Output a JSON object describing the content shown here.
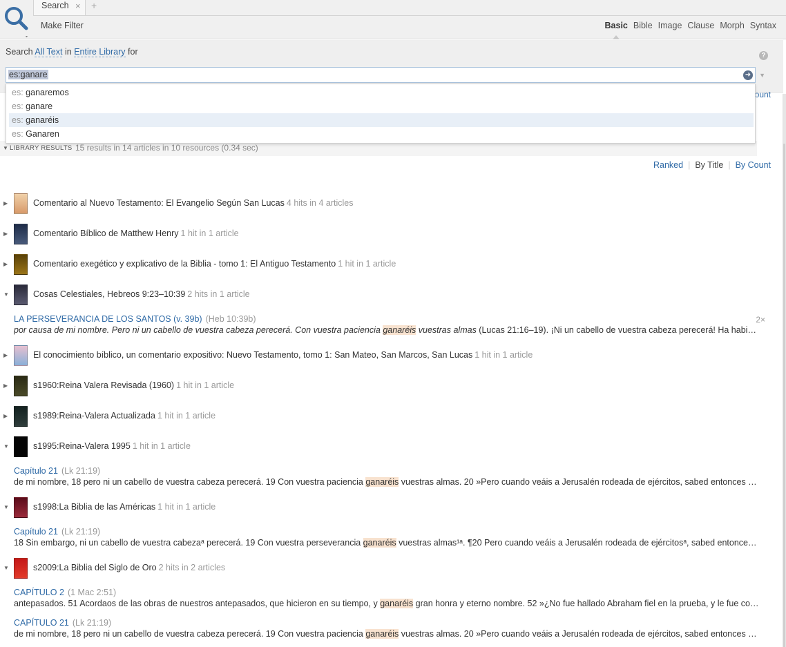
{
  "tab": {
    "label": "Search",
    "close": "×",
    "add": "+"
  },
  "toolbar": {
    "make_filter": "Make Filter",
    "modes": [
      "Basic",
      "Bible",
      "Image",
      "Clause",
      "Morph",
      "Syntax"
    ],
    "active_mode": "Basic"
  },
  "search": {
    "prefix": "Search",
    "scope": "All Text",
    "in": "in",
    "library": "Entire Library",
    "for": "for",
    "query": "es:ganare",
    "help": "?"
  },
  "suggestions": [
    {
      "prefix": "es:",
      "word": "ganaremos"
    },
    {
      "prefix": "es:",
      "word": "ganare"
    },
    {
      "prefix": "es:",
      "word": "ganaréis"
    },
    {
      "prefix": "es:",
      "word": "Ganaren"
    }
  ],
  "partial_count": "ount",
  "results": {
    "title": "Library Results",
    "summary": "15 results in 14 articles in 10 resources (0.34 sec)",
    "sort": [
      "Ranked",
      "By Title",
      "By Count"
    ],
    "active_sort": "By Title"
  },
  "colors": {
    "link": "#2f6aa6",
    "match_highlight": "#f8e2cf"
  },
  "resources": [
    {
      "title": "Comentario al Nuevo Testamento: El Evangelio Según San Lucas",
      "hits": "4 hits in 4 articles",
      "expanded": false,
      "cover": "#e8b88a"
    },
    {
      "title": "Comentario Bíblico de Matthew Henry",
      "hits": "1 hit in 1 article",
      "expanded": false,
      "cover": "#2c3e5a"
    },
    {
      "title": "Comentario exegético y explicativo de la Biblia - tomo 1: El Antiguo Testamento",
      "hits": "1 hit in 1 article",
      "expanded": false,
      "cover": "#7a5a10"
    },
    {
      "title": "Cosas Celestiales, Hebreos 9:23–10:39",
      "hits": "2 hits in 1 article",
      "expanded": true,
      "cover": "#3c3c50",
      "hits_list": [
        {
          "heading": "LA PERSEVERANCIA DE LOS SANTOS (v. 39b)",
          "ref": "(Heb 10:39b)",
          "before": "por causa de mi nombre. Pero ni un cabello de vuestra cabeza perecerá. Con vuestra paciencia ",
          "match": "ganaréis",
          "after": " vuestras almas",
          "tail": " (Lucas 21:16–19). ¡Ni un cabello de vuestra cabeza perecerá! Ha habido…",
          "count": "2×"
        }
      ]
    },
    {
      "title": "El conocimiento bíblico, un comentario expositivo: Nuevo Testamento, tomo 1: San Mateo, San Marcos, San Lucas",
      "hits": "1 hit in 1 article",
      "expanded": false,
      "cover": "#c9a0b0"
    },
    {
      "title": "s1960:Reina Valera Revisada (1960)",
      "hits": "1 hit in 1 article",
      "expanded": false,
      "cover": "#3a3a20"
    },
    {
      "title": "s1989:Reina-Valera Actualizada",
      "hits": "1 hit in 1 article",
      "expanded": false,
      "cover": "#1c2a28"
    },
    {
      "title": "s1995:Reina-Valera 1995",
      "hits": "1 hit in 1 article",
      "expanded": true,
      "cover": "#0c0c0c",
      "hits_list": [
        {
          "heading": "Capítulo 21",
          "ref": "(Lk 21:19)",
          "before": "de mi nombre, 18 pero ni un cabello de vuestra cabeza perecerá. 19 Con vuestra paciencia ",
          "match": "ganaréis",
          "after": " vuestras almas. 20 »Pero cuando veáis a Jerusalén rodeada de ejércitos, sabed entonces que…"
        }
      ]
    },
    {
      "title": "s1998:La Biblia de las Américas",
      "hits": "1 hit in 1 article",
      "expanded": true,
      "cover": "#6a1020",
      "hits_list": [
        {
          "heading": "Capítulo 21",
          "ref": "(Lk 21:19)",
          "before": "18 Sin embargo, ni un cabello de vuestra cabezaᵃ perecerá. 19 Con vuestra perseverancia ",
          "match": "ganaréis",
          "after": " vuestras almas¹ᵃ. ¶20 Pero cuando veáis a Jerusalén rodeada de ejércitosᵃ, sabed entonces…"
        }
      ]
    },
    {
      "title": "s2009:La Biblia del Siglo de Oro",
      "hits": "2 hits in 2 articles",
      "expanded": true,
      "cover": "#c42020",
      "hits_list": [
        {
          "heading": "CAPÍTULO 2",
          "ref": "(1 Mac 2:51)",
          "before": "antepasados. 51 Acordaos de las obras de nuestros antepasados, que hicieron en su tiempo, y ",
          "match": "ganaréis",
          "after": " gran honra y eterno nombre. 52 »¿No fue hallado Abraham fiel en la prueba, y le fue contado…"
        },
        {
          "heading": "CAPÍTULO 21",
          "ref": "(Lk 21:19)",
          "before": "de mi nombre, 18 pero ni un cabello de vuestra cabeza perecerá. 19 Con vuestra paciencia ",
          "match": "ganaréis",
          "after": " vuestras almas. 20 »Pero cuando veáis a Jerusalén rodeada de ejércitos, sabed entonces que su…"
        }
      ]
    }
  ]
}
